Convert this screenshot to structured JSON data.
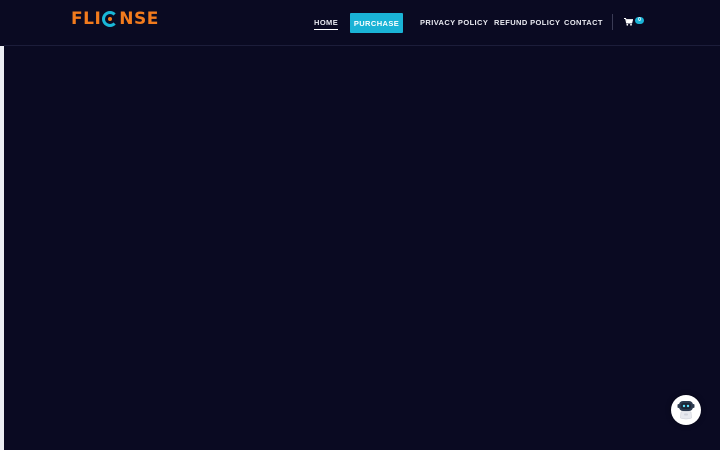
{
  "brand": {
    "logo_text_left": "FLI",
    "logo_text_right": "NSE",
    "colors": {
      "orange": "#f27b1d",
      "cyan": "#19b7d8"
    }
  },
  "nav": {
    "home": "HOME",
    "purchase": "PURCHASE",
    "privacy": "PRIVACY POLICY",
    "refund": "REFUND POLICY",
    "contact": "CONTACT"
  },
  "cart": {
    "icon": "shopping-cart-icon",
    "count": "0"
  },
  "chat": {
    "icon": "robot-chat-icon"
  },
  "theme": {
    "background": "#0a0a22",
    "accent": "#1ab3d6"
  }
}
